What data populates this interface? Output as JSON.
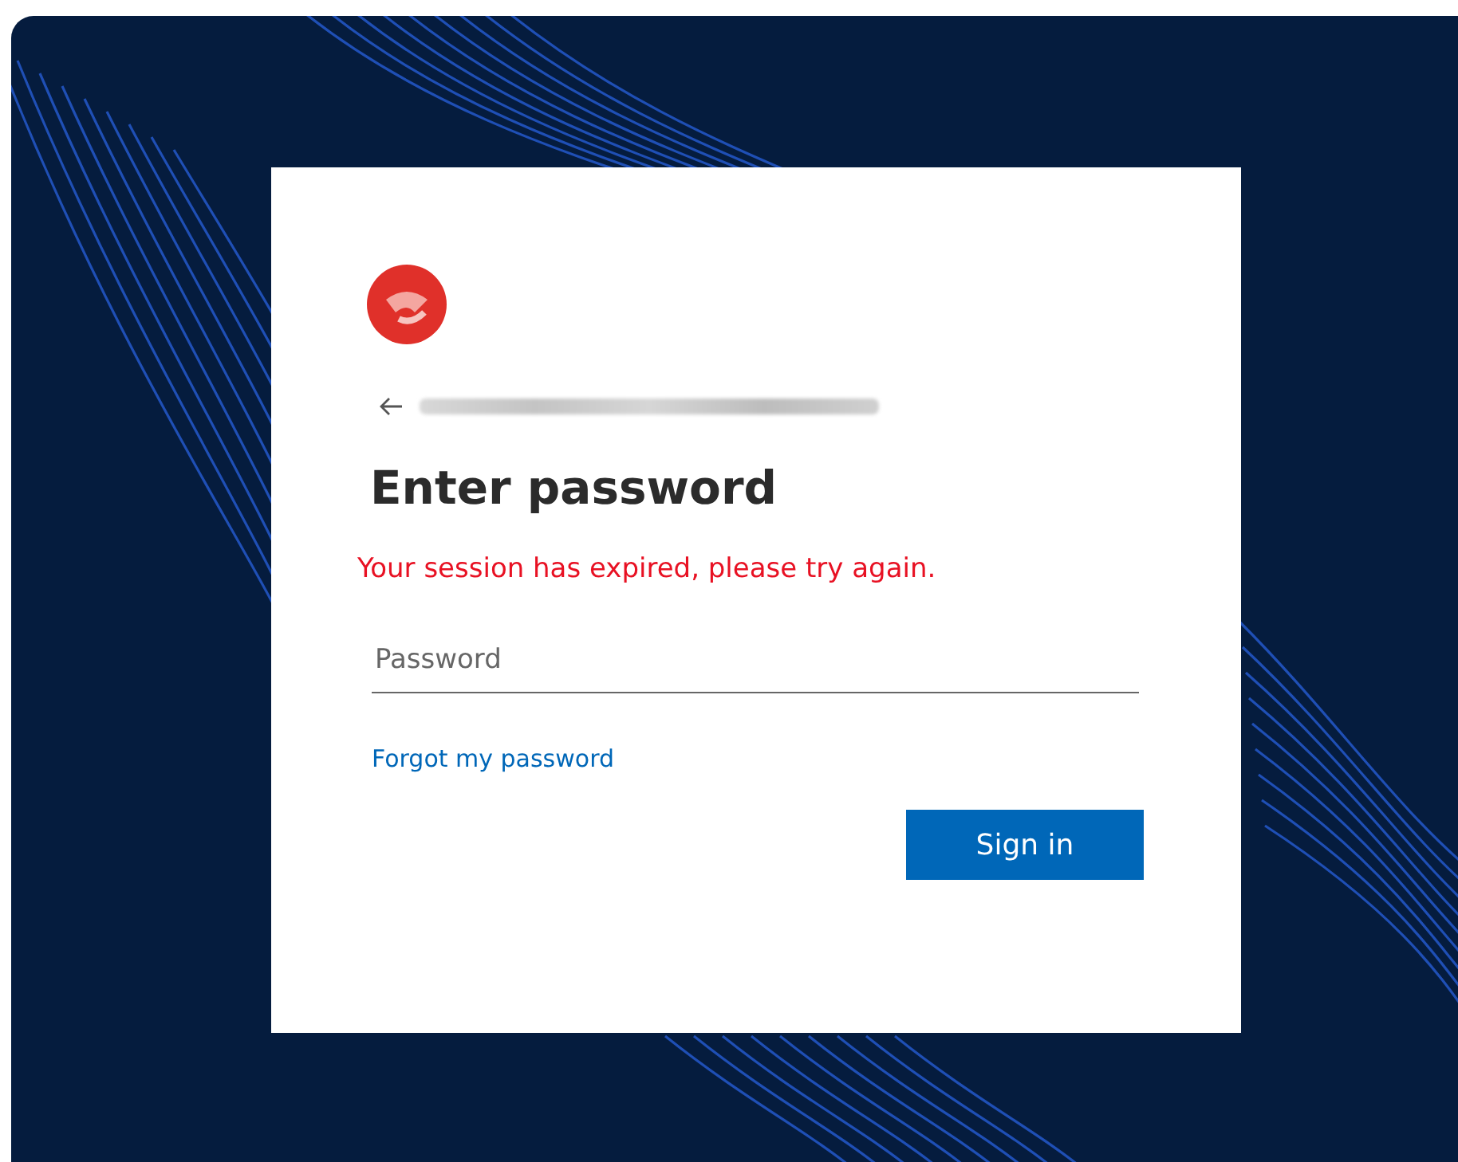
{
  "dialog": {
    "title": "Enter password",
    "error": "Your session has expired, please try again.",
    "password_field": {
      "placeholder": "Password"
    },
    "forgot_link": "Forgot my password",
    "sign_in_button": "Sign in"
  }
}
